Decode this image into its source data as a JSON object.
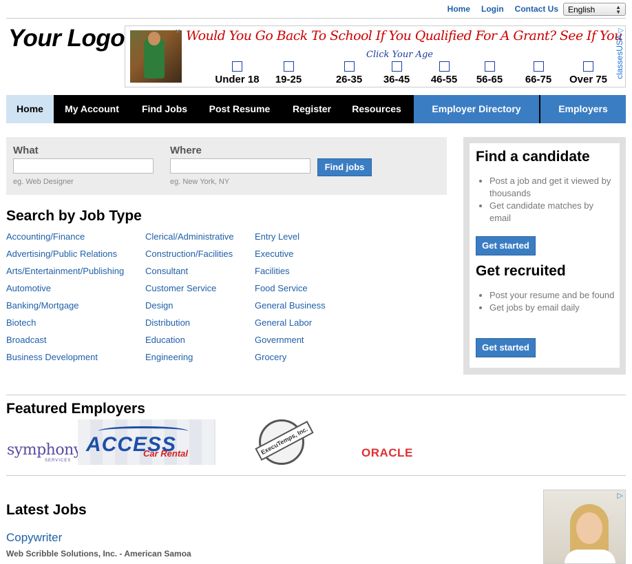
{
  "header": {
    "links": [
      "Home",
      "Login",
      "Contact Us"
    ],
    "language": "English",
    "logo": "Your Logo"
  },
  "ad_banner": {
    "headline": "Would You Go Back To School If You Qualified For A Grant? See If You Qualify!",
    "subline": "Click Your Age",
    "ages": [
      "Under 18",
      "19-25",
      "26-35",
      "36-45",
      "46-55",
      "56-65",
      "66-75",
      "Over 75"
    ],
    "sponsor": "classesUSA",
    "adchoices_icon": "adchoices-icon"
  },
  "nav": {
    "items": [
      "Home",
      "My Account",
      "Find Jobs",
      "Post Resume",
      "Register",
      "Resources"
    ],
    "employer_directory": "Employer Directory",
    "employers": "Employers"
  },
  "search": {
    "what_label": "What",
    "what_value": "",
    "what_hint": "eg. Web Designer",
    "where_label": "Where",
    "where_value": "",
    "where_hint": "eg. New York, NY",
    "button": "Find jobs"
  },
  "job_types": {
    "title": "Search by Job Type",
    "col1": [
      "Accounting/Finance",
      "Advertising/Public Relations",
      "Arts/Entertainment/Publishing",
      "Automotive",
      "Banking/Mortgage",
      "Biotech",
      "Broadcast",
      "Business Development"
    ],
    "col2": [
      "Clerical/Administrative",
      "Construction/Facilities",
      "Consultant",
      "Customer Service",
      "Design",
      "Distribution",
      "Education",
      "Engineering"
    ],
    "col3": [
      "Entry Level",
      "Executive",
      "Facilities",
      "Food Service",
      "General Business",
      "General Labor",
      "Government",
      "Grocery"
    ]
  },
  "sidebar": {
    "find_title": "Find a candidate",
    "find_points": [
      "Post a job and get it viewed by thousands",
      "Get candidate matches by email"
    ],
    "find_button": "Get started",
    "recruit_title": "Get recruited",
    "recruit_points": [
      "Post your resume and be found",
      "Get jobs by email daily"
    ],
    "recruit_button": "Get started"
  },
  "featured": {
    "title": "Featured Employers",
    "symphony": "symphony",
    "symphony_sub": "SERVICES",
    "access": "ACCESS",
    "access_sub": "Car Rental",
    "execu": "ExecuTemps, Inc.",
    "oracle": "ORACLE"
  },
  "latest": {
    "title": "Latest Jobs",
    "job_title": "Copywriter",
    "job_company": "Web Scribble Solutions, Inc. - American Samoa"
  }
}
